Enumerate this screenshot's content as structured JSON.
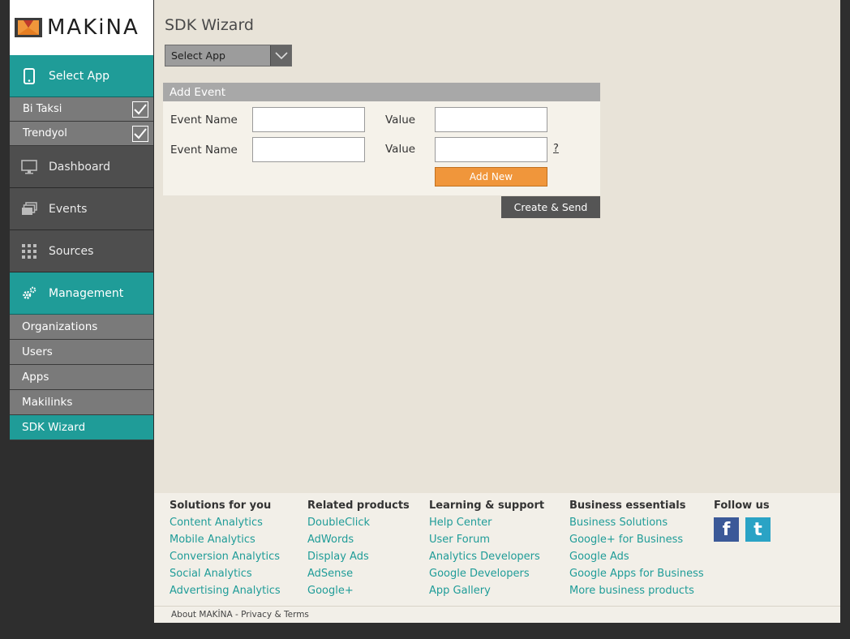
{
  "logo": {
    "text": "MAKiNA"
  },
  "sidebar": {
    "select_app_label": "Select App",
    "apps": [
      {
        "label": "Bi Taksi",
        "checked": true
      },
      {
        "label": "Trendyol",
        "checked": true
      }
    ],
    "nav": [
      {
        "label": "Dashboard",
        "icon": "monitor-icon"
      },
      {
        "label": "Events",
        "icon": "stack-icon"
      },
      {
        "label": "Sources",
        "icon": "grid-icon"
      }
    ],
    "management_label": "Management",
    "management_items": [
      {
        "label": "Organizations"
      },
      {
        "label": "Users"
      },
      {
        "label": "Apps"
      },
      {
        "label": "Makilinks"
      },
      {
        "label": "SDK Wizard",
        "active": true
      }
    ]
  },
  "main": {
    "title": "SDK Wizard",
    "select_app": "Select App",
    "panel": {
      "title": "Add Event",
      "rows": [
        {
          "name_label": "Event Name",
          "name_value": "",
          "value_label": "Value",
          "value_value": ""
        },
        {
          "name_label": "Event Name",
          "name_value": "",
          "value_label": "Value",
          "value_value": ""
        }
      ],
      "help": "?",
      "add_new": "Add New"
    },
    "create_send": "Create & Send"
  },
  "footer": {
    "columns": [
      {
        "title": "Solutions for you",
        "links": [
          "Content Analytics",
          "Mobile Analytics",
          "Conversion Analytics",
          "Social Analytics",
          "Advertising Analytics"
        ]
      },
      {
        "title": "Related products",
        "links": [
          "DoubleClick",
          "AdWords",
          "Display Ads",
          "AdSense",
          "Google+"
        ]
      },
      {
        "title": "Learning & support",
        "links": [
          "Help Center",
          "User Forum",
          "Analytics Developers",
          "Google Developers",
          "App Gallery"
        ]
      },
      {
        "title": "Business essentials",
        "links": [
          "Business Solutions",
          "Google+ for Business",
          "Google Ads",
          "Google Apps for Business",
          "More business products"
        ]
      }
    ],
    "follow_title": "Follow us",
    "social": [
      {
        "name": "facebook-icon",
        "glyph": "f",
        "color": "#3b5998"
      },
      {
        "name": "twitter-icon",
        "glyph": "t",
        "color": "#2aa3c5"
      }
    ],
    "bottom": "About MAKİNA - Privacy & Terms"
  },
  "colors": {
    "teal": "#1f9c98",
    "orange": "#f0963b",
    "dark": "#2e2e2e",
    "main_bg": "#e8e3d8"
  }
}
